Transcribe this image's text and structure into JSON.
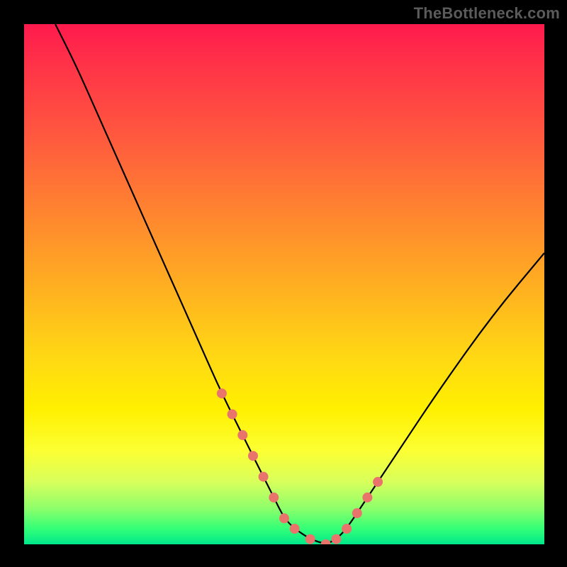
{
  "watermark": "TheBottleneck.com",
  "colors": {
    "background": "#000000",
    "curve": "#000000",
    "marker": "#e9746c",
    "gradient_stops": [
      "#ff1a4d",
      "#ff3348",
      "#ff5a3e",
      "#ff8a2e",
      "#ffb41f",
      "#ffd814",
      "#fff000",
      "#fcff33",
      "#d8ff5c",
      "#8fff6a",
      "#33ff77",
      "#00e88c"
    ]
  },
  "chart_data": {
    "type": "line",
    "title": "",
    "xlabel": "",
    "ylabel": "",
    "xlim": [
      0,
      100
    ],
    "ylim": [
      0,
      100
    ],
    "grid": false,
    "legend": false,
    "series": [
      {
        "name": "bottleneck-curve",
        "x": [
          6,
          10,
          14,
          18,
          22,
          26,
          30,
          34,
          38,
          42,
          46,
          48,
          50,
          52,
          55,
          58,
          60,
          62,
          66,
          72,
          80,
          90,
          100
        ],
        "y": [
          100,
          92,
          83,
          74,
          65,
          56,
          47,
          38,
          29,
          21,
          13,
          9,
          5,
          3,
          1,
          0,
          1,
          3,
          9,
          18,
          30,
          44,
          56
        ]
      }
    ],
    "markers": {
      "name": "highlight-dots",
      "color": "#e9746c",
      "x": [
        38,
        40,
        42,
        44,
        46,
        48,
        50,
        52,
        55,
        58,
        60,
        62,
        64,
        66,
        68
      ],
      "y": [
        29,
        25,
        21,
        17,
        13,
        9,
        5,
        3,
        1,
        0,
        1,
        3,
        6,
        9,
        12
      ]
    }
  }
}
